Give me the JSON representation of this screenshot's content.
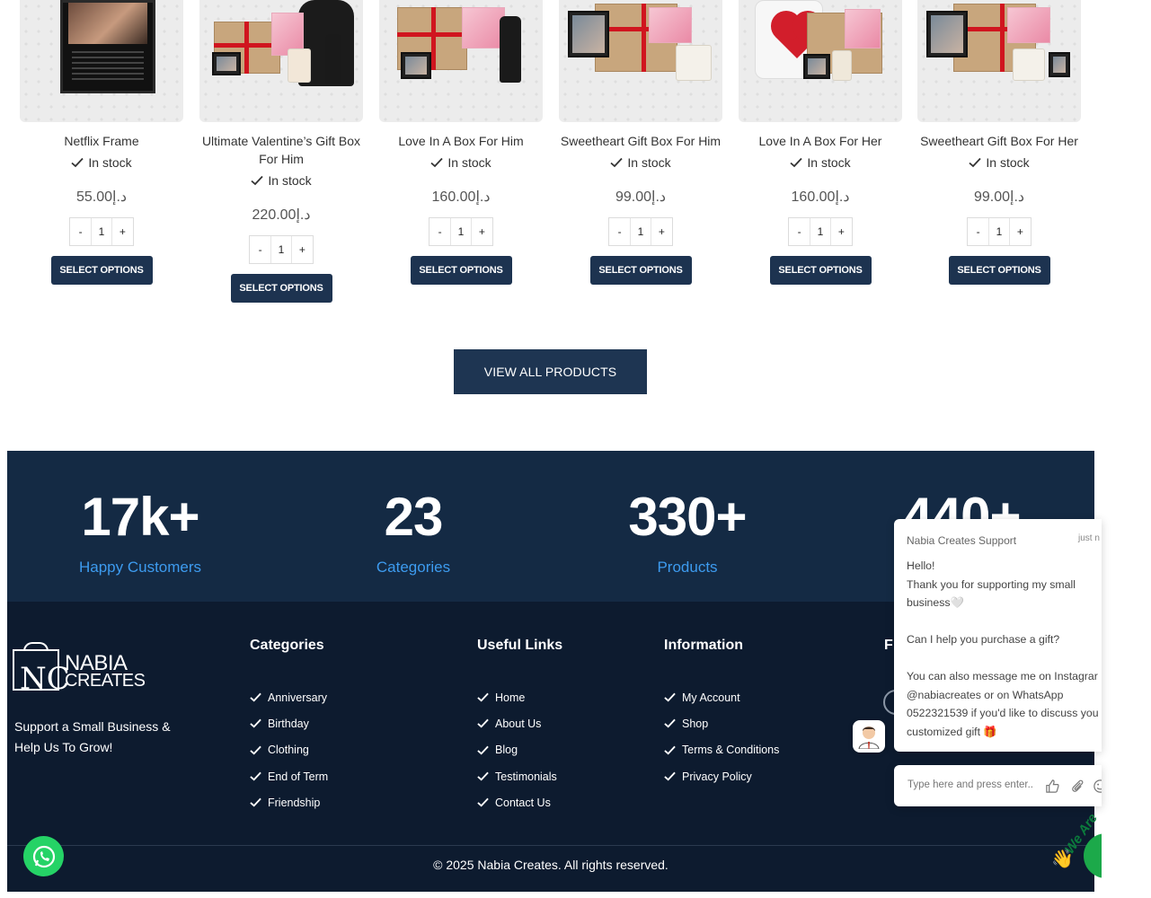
{
  "products": [
    {
      "title": "Netflix Frame",
      "stock": "In stock",
      "price": "55.00د.إ",
      "qty": "1",
      "button": "SELECT OPTIONS"
    },
    {
      "title": "Ultimate Valentine’s Gift Box For Him",
      "stock": "In stock",
      "price": "220.00د.إ",
      "qty": "1",
      "button": "SELECT OPTIONS"
    },
    {
      "title": "Love In A Box For Him",
      "stock": "In stock",
      "price": "160.00د.إ",
      "qty": "1",
      "button": "SELECT OPTIONS"
    },
    {
      "title": "Sweetheart Gift Box For Him",
      "stock": "In stock",
      "price": "99.00د.إ",
      "qty": "1",
      "button": "SELECT OPTIONS"
    },
    {
      "title": "Love In A Box For Her",
      "stock": "In stock",
      "price": "160.00د.إ",
      "qty": "1",
      "button": "SELECT OPTIONS"
    },
    {
      "title": "Sweetheart Gift Box For Her",
      "stock": "In stock",
      "price": "99.00د.إ",
      "qty": "1",
      "button": "SELECT OPTIONS"
    }
  ],
  "qty_minus": "-",
  "qty_plus": "+",
  "view_all": "VIEW ALL PRODUCTS",
  "stats": [
    {
      "number": "17k+",
      "label": "Happy Customers"
    },
    {
      "number": "23",
      "label": "Categories"
    },
    {
      "number": "330+",
      "label": "Products"
    },
    {
      "number": "440+",
      "label": ""
    }
  ],
  "footer": {
    "logo_line1": "NABIA",
    "logo_line2": "CREATES",
    "logo_mark": "NC",
    "tagline": "Support a Small Business & Help Us To Grow!",
    "categories_title": "Categories",
    "categories": [
      "Anniversary",
      "Birthday",
      "Clothing",
      "End of Term",
      "Friendship"
    ],
    "useful_title": "Useful Links",
    "useful": [
      "Home",
      "About Us",
      "Blog",
      "Testimonials",
      "Contact Us"
    ],
    "info_title": "Information",
    "info": [
      "My Account",
      "Shop",
      "Terms & Conditions",
      "Privacy Policy"
    ],
    "follow_title_clipped": "F",
    "copyright": "© 2025 Nabia Creates. All rights reserved."
  },
  "chat": {
    "sender": "Nabia Creates Support",
    "time": "just n",
    "lines": [
      "Hello!",
      "Thank you for supporting my small",
      "business🤍",
      "",
      "Can I help you purchase a gift?",
      "",
      "You can also message me on Instagrar",
      "@nabiacreates or on WhatsApp",
      "0522321539 if you'd like to discuss you",
      "customized gift 🎁"
    ],
    "placeholder": "Type here and press enter..",
    "badge": "We Are"
  },
  "colors": {
    "navy": "#1d3350",
    "stats_bg": "#142a44",
    "footer_bg": "#0d1b2f",
    "accent_blue": "#3d9bef",
    "whatsapp": "#25d366"
  }
}
